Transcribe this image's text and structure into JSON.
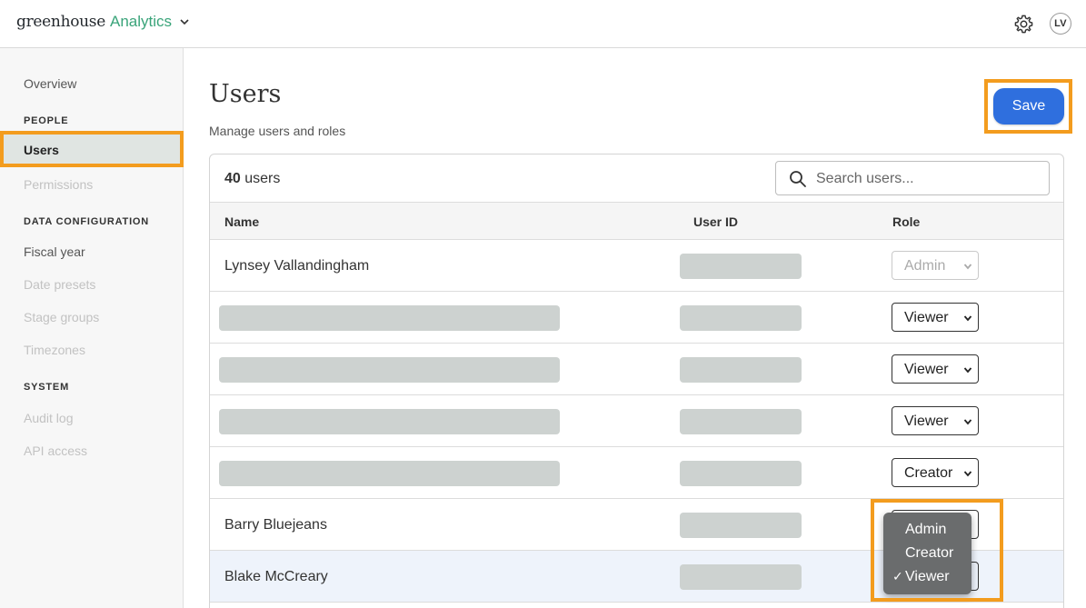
{
  "header": {
    "brand_main": "greenhouse",
    "brand_product": "Analytics",
    "avatar_initials": "LV"
  },
  "sidebar": {
    "overview": "Overview",
    "section_people": "PEOPLE",
    "users": "Users",
    "permissions": "Permissions",
    "section_data": "DATA CONFIGURATION",
    "fiscal_year": "Fiscal year",
    "date_presets": "Date presets",
    "stage_groups": "Stage groups",
    "timezones": "Timezones",
    "section_system": "SYSTEM",
    "audit_log": "Audit log",
    "api_access": "API access"
  },
  "main": {
    "title": "Users",
    "subtitle": "Manage users and roles",
    "save_label": "Save",
    "count_number": "40",
    "count_suffix": " users",
    "search_placeholder": "Search users...",
    "columns": {
      "name": "Name",
      "user_id": "User ID",
      "role": "Role"
    }
  },
  "rows": [
    {
      "name": "Lynsey Vallandingham",
      "role": "Admin"
    },
    {
      "name": "",
      "role": "Viewer"
    },
    {
      "name": "",
      "role": "Viewer"
    },
    {
      "name": "",
      "role": "Viewer"
    },
    {
      "name": "",
      "role": "Creator"
    },
    {
      "name": "Barry Bluejeans",
      "role": ""
    },
    {
      "name": "Blake McCreary",
      "role": ""
    }
  ],
  "role_popup": {
    "options": [
      "Admin",
      "Creator",
      "Viewer"
    ],
    "check": "✓"
  },
  "colors": {
    "brand_green": "#3aa47a",
    "save_blue": "#2f6fde",
    "highlight_orange": "#f39c1e"
  }
}
